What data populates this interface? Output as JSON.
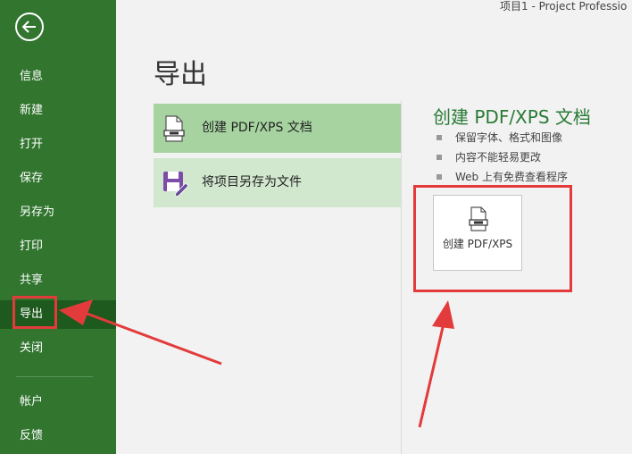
{
  "window": {
    "title": "项目1  -  Project Professio"
  },
  "sidebar": {
    "items": [
      {
        "label": "信息"
      },
      {
        "label": "新建"
      },
      {
        "label": "打开"
      },
      {
        "label": "保存"
      },
      {
        "label": "另存为"
      },
      {
        "label": "打印"
      },
      {
        "label": "共享"
      },
      {
        "label": "导出"
      },
      {
        "label": "关闭"
      },
      {
        "label": "帐户"
      },
      {
        "label": "反馈"
      }
    ],
    "active": "导出"
  },
  "main": {
    "title": "导出",
    "options": [
      {
        "label": "创建 PDF/XPS 文档",
        "icon": "pdf-document-icon",
        "selected": true
      },
      {
        "label": "将项目另存为文件",
        "icon": "save-as-file-icon",
        "selected": false
      }
    ]
  },
  "detail": {
    "title": "创建 PDF/XPS 文档",
    "bullets": [
      "保留字体、格式和图像",
      "内容不能轻易更改",
      "Web 上有免费查看程序"
    ],
    "button_label": "创建 PDF/XPS"
  },
  "colors": {
    "sidebar": "#31752f",
    "sidebar_active": "#1e5a1e",
    "option_selected": "#a6d3a0",
    "option_normal": "#d1e8cf",
    "accent_title": "#2a7a36",
    "annotation": "#e33b3b"
  }
}
